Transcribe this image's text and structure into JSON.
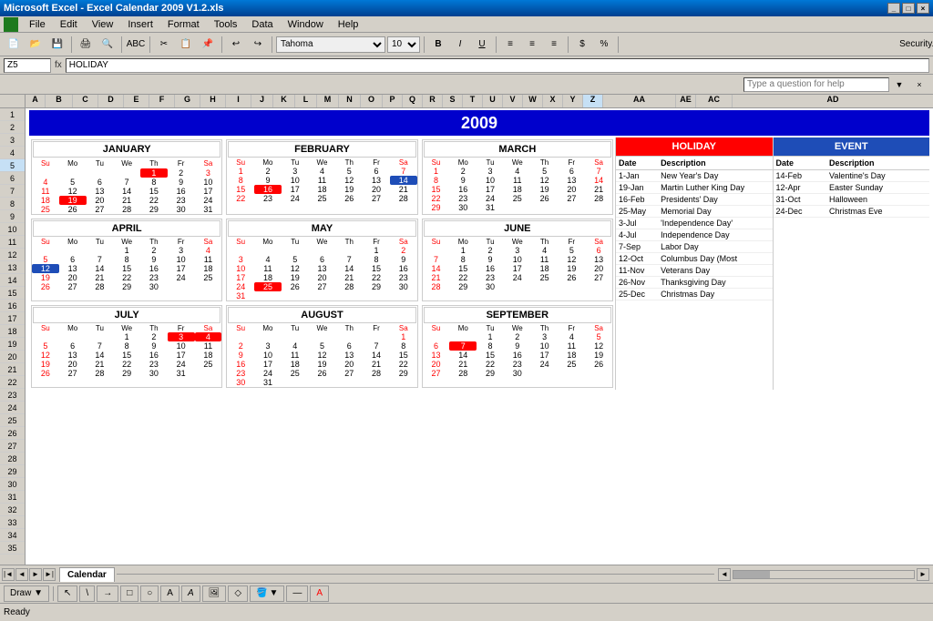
{
  "titleBar": {
    "title": "Microsoft Excel - Excel Calendar 2009 V1.2.xls",
    "controls": [
      "_",
      "□",
      "×"
    ]
  },
  "menuBar": {
    "items": [
      "File",
      "Edit",
      "View",
      "Insert",
      "Format",
      "Tools",
      "Data",
      "Window",
      "Help"
    ]
  },
  "formulaBar": {
    "cellRef": "Z5",
    "value": "HOLIDAY"
  },
  "helpBar": {
    "placeholder": "Type a question for help"
  },
  "year": "2009",
  "months": [
    {
      "name": "JANUARY",
      "startDay": 4,
      "days": 31,
      "holidays": [
        1
      ],
      "events": []
    },
    {
      "name": "FEBRUARY",
      "startDay": 0,
      "days": 28,
      "holidays": [
        16
      ],
      "events": [
        14
      ]
    },
    {
      "name": "MARCH",
      "startDay": 0,
      "days": 31,
      "holidays": [],
      "events": []
    },
    {
      "name": "APRIL",
      "startDay": 3,
      "days": 30,
      "holidays": [
        12
      ],
      "events": []
    },
    {
      "name": "MAY",
      "startDay": 5,
      "days": 31,
      "holidays": [
        25
      ],
      "events": []
    },
    {
      "name": "JUNE",
      "startDay": 1,
      "days": 30,
      "holidays": [],
      "events": []
    },
    {
      "name": "JULY",
      "startDay": 3,
      "days": 31,
      "holidays": [
        3,
        4
      ],
      "events": []
    },
    {
      "name": "AUGUST",
      "startDay": 6,
      "days": 31,
      "holidays": [],
      "events": []
    },
    {
      "name": "SEPTEMBER",
      "startDay": 2,
      "days": 30,
      "holidays": [
        7
      ],
      "events": []
    }
  ],
  "holidayPanel": {
    "title": "HOLIDAY",
    "headers": [
      "Date",
      "Description"
    ],
    "rows": [
      [
        "1-Jan",
        "New Year's Day"
      ],
      [
        "19-Jan",
        "Martin Luther King Day"
      ],
      [
        "16-Feb",
        "Presidents' Day"
      ],
      [
        "25-May",
        "Memorial Day"
      ],
      [
        "3-Jul",
        "'Independence Day'"
      ],
      [
        "4-Jul",
        "Independence Day"
      ],
      [
        "7-Sep",
        "Labor Day"
      ],
      [
        "12-Oct",
        "Columbus Day (Most"
      ],
      [
        "11-Nov",
        "Veterans Day"
      ],
      [
        "26-Nov",
        "Thanksgiving Day"
      ],
      [
        "25-Dec",
        "Christmas Day"
      ]
    ]
  },
  "eventPanel": {
    "title": "EVENT",
    "headers": [
      "Date",
      "Description"
    ],
    "rows": [
      [
        "14-Feb",
        "Valentine's Day"
      ],
      [
        "12-Apr",
        "Easter Sunday"
      ],
      [
        "31-Oct",
        "Halloween"
      ],
      [
        "24-Dec",
        "Christmas Eve"
      ]
    ]
  },
  "sheetTabs": [
    "Calendar"
  ],
  "statusBar": "Ready",
  "drawToolbar": "Draw ▼"
}
